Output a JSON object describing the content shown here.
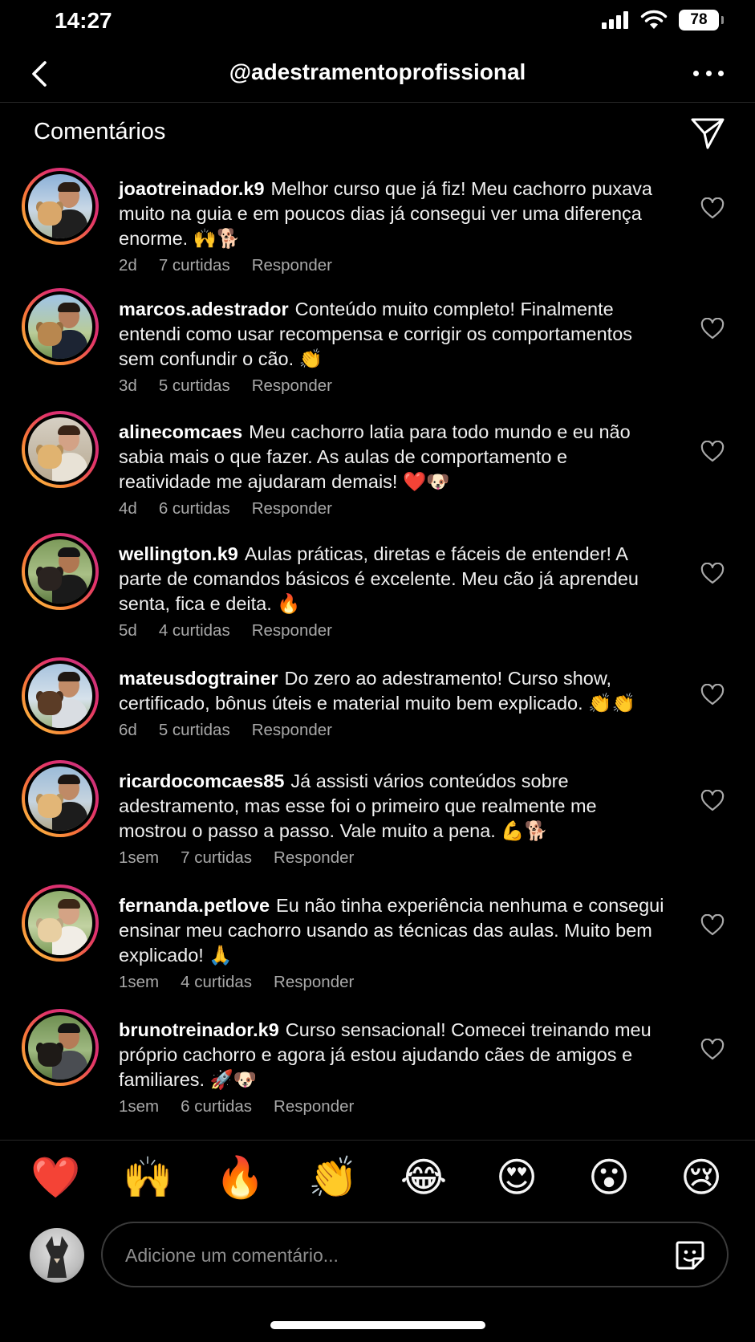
{
  "status": {
    "time": "14:27",
    "battery": "78",
    "icons": [
      "signal-icon",
      "wifi-icon",
      "battery-icon"
    ]
  },
  "header": {
    "title": "@adestramentoprofissional",
    "back_icon": "chevron-left-icon",
    "more_icon": "ellipsis-icon"
  },
  "section": {
    "title": "Comentários",
    "share_icon": "send-icon"
  },
  "comments": [
    {
      "user": "joaotreinador.k9",
      "text": "Melhor curso que já fiz! Meu cachorro puxava muito na guia e em poucos dias já consegui ver uma diferença enorme. 🙌🐕",
      "time": "2d",
      "likes": "7 curtidas",
      "reply": "Responder"
    },
    {
      "user": "marcos.adestrador",
      "text": "Conteúdo muito completo! Finalmente entendi como usar recompensa e corrigir os comportamentos sem confundir o cão. 👏",
      "time": "3d",
      "likes": "5 curtidas",
      "reply": "Responder"
    },
    {
      "user": "alinecomcaes",
      "text": "Meu cachorro latia para todo mundo e eu não sabia mais o que fazer. As aulas de comportamento e reatividade me ajudaram demais! ❤️🐶",
      "time": "4d",
      "likes": "6 curtidas",
      "reply": "Responder"
    },
    {
      "user": "wellington.k9",
      "text": "Aulas práticas, diretas e fáceis de entender! A parte de comandos básicos é excelente. Meu cão já aprendeu senta, fica e deita. 🔥",
      "time": "5d",
      "likes": "4 curtidas",
      "reply": "Responder"
    },
    {
      "user": "mateusdogtrainer",
      "text": "Do zero ao adestramento! Curso show, certificado, bônus úteis e material muito bem explicado. 👏👏",
      "time": "6d",
      "likes": "5 curtidas",
      "reply": "Responder"
    },
    {
      "user": "ricardocomcaes85",
      "text": "Já assisti vários conteúdos sobre adestramento, mas esse foi o primeiro que realmente me mostrou o passo a passo. Vale muito a pena. 💪🐕",
      "time": "1sem",
      "likes": "7 curtidas",
      "reply": "Responder"
    },
    {
      "user": "fernanda.petlove",
      "text": "Eu não tinha experiência nenhuma e consegui ensinar meu cachorro usando as técnicas das aulas. Muito bem explicado! 🙏",
      "time": "1sem",
      "likes": "4 curtidas",
      "reply": "Responder"
    },
    {
      "user": "brunotreinador.k9",
      "text": "Curso sensacional! Comecei treinando meu próprio cachorro e agora já estou ajudando cães de amigos e familiares. 🚀🐶",
      "time": "1sem",
      "likes": "6 curtidas",
      "reply": "Responder"
    }
  ],
  "reactions": [
    "❤️",
    "🙌",
    "🔥",
    "👏",
    "😂",
    "😍",
    "😮",
    "😢"
  ],
  "composer": {
    "placeholder": "Adicione um comentário...",
    "sticker_icon": "sticker-icon"
  },
  "colors": {
    "background": "#000000",
    "text": "#f5f5f5",
    "muted": "#a8a8a8",
    "story_ring_start": "#fdd145",
    "story_ring_end": "#c13584"
  }
}
